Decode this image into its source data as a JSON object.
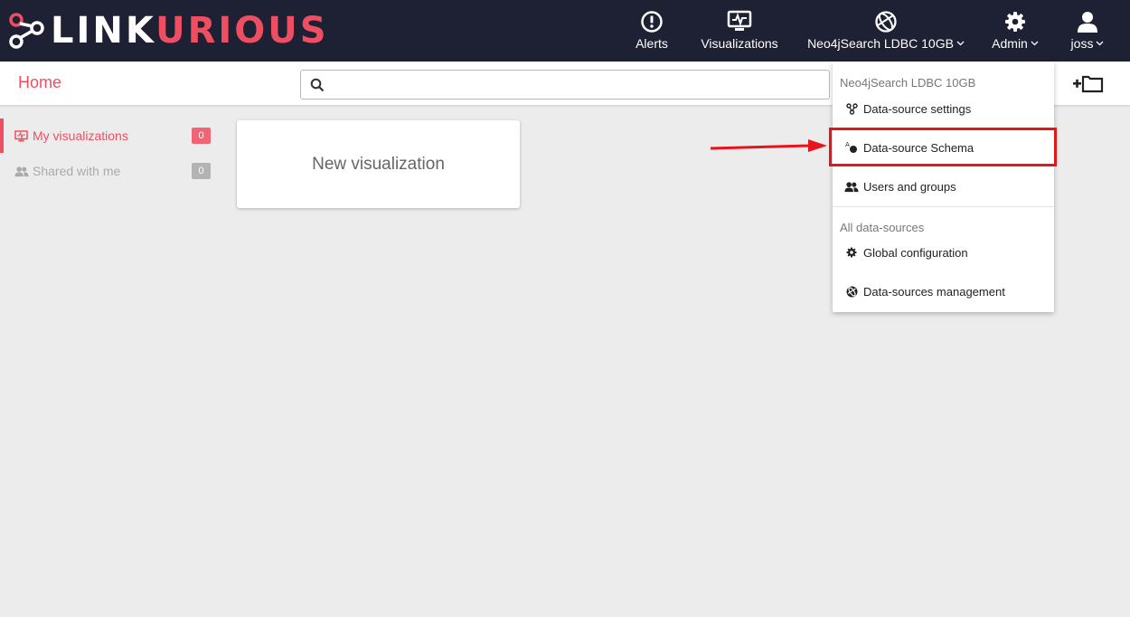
{
  "brand": {
    "part1": "LINK",
    "part2": "URIOUS"
  },
  "nav": {
    "alerts": "Alerts",
    "visualizations": "Visualizations",
    "datasource": "Neo4jSearch LDBC 10GB",
    "admin": "Admin",
    "user": "joss"
  },
  "subbar": {
    "title": "Home",
    "search_value": "",
    "search_placeholder": ""
  },
  "sidebar": {
    "items": [
      {
        "label": "My visualizations",
        "count": "0"
      },
      {
        "label": "Shared with me",
        "count": "0"
      }
    ]
  },
  "card": {
    "label": "New visualization"
  },
  "dropdown": {
    "header1": "Neo4jSearch LDBC 10GB",
    "items1": [
      {
        "label": "Data-source settings",
        "icon": "datasource-settings-icon"
      },
      {
        "label": "Data-source Schema",
        "icon": "schema-icon"
      },
      {
        "label": "Users and groups",
        "icon": "users-icon"
      }
    ],
    "header2": "All data-sources",
    "items2": [
      {
        "label": "Global configuration",
        "icon": "gear-icon"
      },
      {
        "label": "Data-sources management",
        "icon": "globe-icon"
      }
    ]
  },
  "colors": {
    "accent": "#ee4e61",
    "nav_bg": "#1e2033",
    "highlight": "#e8141b"
  }
}
